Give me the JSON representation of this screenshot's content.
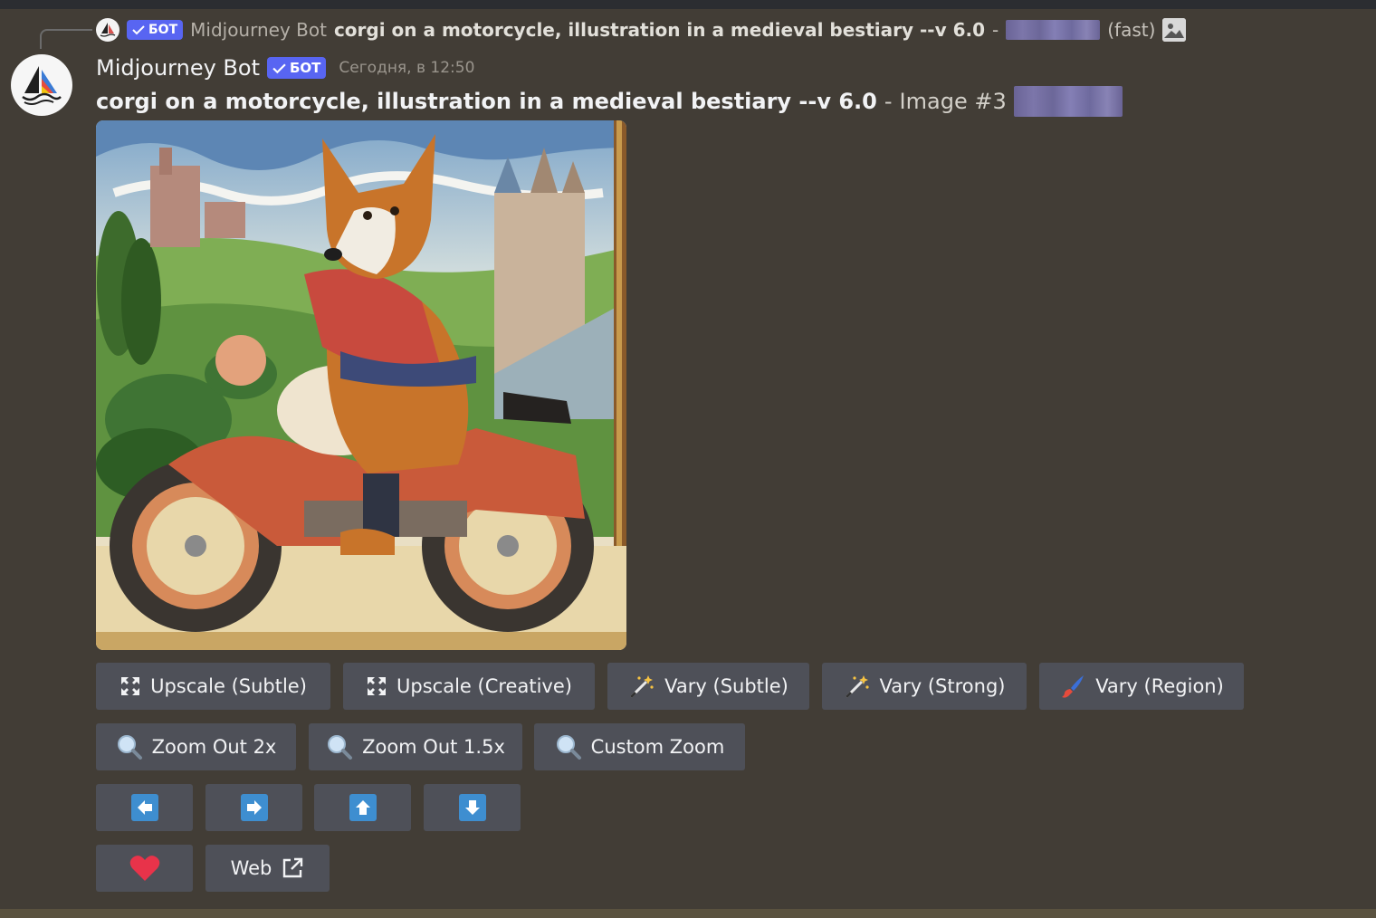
{
  "reply": {
    "bot_badge": "БОТ",
    "author": "Midjourney Bot",
    "prompt": "corgi on a motorcycle, illustration in a medieval bestiary --v 6.0",
    "separator": "-",
    "speed": "(fast)"
  },
  "message": {
    "author": "Midjourney Bot",
    "bot_badge": "БОТ",
    "timestamp": "Сегодня, в 12:50",
    "prompt": "corgi on a motorcycle, illustration in a medieval bestiary --v 6.0",
    "separator": "-",
    "image_label": "Image #3"
  },
  "buttons": {
    "row1": {
      "upscale_subtle": "Upscale (Subtle)",
      "upscale_creative": "Upscale (Creative)",
      "vary_subtle": "Vary (Subtle)",
      "vary_strong": "Vary (Strong)",
      "vary_region": "Vary (Region)"
    },
    "row2": {
      "zoom_out_2x": "Zoom Out 2x",
      "zoom_out_1_5x": "Zoom Out 1.5x",
      "custom_zoom": "Custom Zoom"
    },
    "row4": {
      "web": "Web"
    }
  },
  "icons": {
    "upscale": "expand-arrows-icon",
    "vary": "magic-wand-icon",
    "region": "paintbrush-icon",
    "zoom": "magnifier-icon",
    "pan": [
      "arrow-left-icon",
      "arrow-right-icon",
      "arrow-up-icon",
      "arrow-down-icon"
    ],
    "favorite": "heart-icon",
    "external": "external-link-icon"
  },
  "colors": {
    "background": "#423d36",
    "button": "#4e5058",
    "badge": "#5865f2",
    "arrow": "#3e8ed0",
    "heart": "#e8334a"
  }
}
